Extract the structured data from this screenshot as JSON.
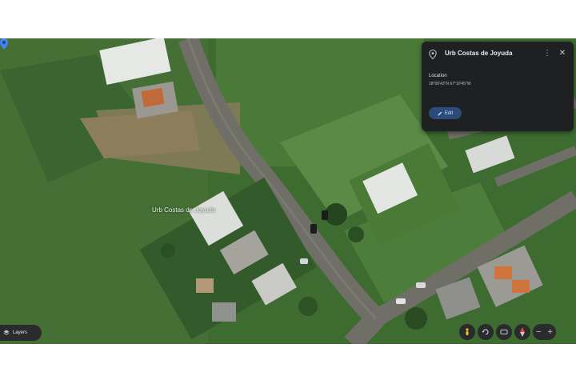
{
  "map": {
    "place_label": "Urb Costas de Joyuda"
  },
  "info_card": {
    "title": "Urb Costas de Joyuda",
    "location_label": "Location",
    "coordinates": "18°06'43\"N 67°10'45\"W",
    "edit_label": "Edit",
    "more_icon": "more-vert-icon",
    "close_icon": "close-icon"
  },
  "layers_button": {
    "label": "Layers",
    "icon": "layers-icon"
  },
  "map_controls": {
    "icons": [
      "pegman-icon",
      "rotate-icon",
      "tilt-icon",
      "compass-icon"
    ],
    "zoom_out": "−",
    "zoom_in": "+"
  },
  "colors": {
    "card_bg": "#1f2021",
    "pin_blue": "#4285f4",
    "edit_bg": "#2b4c7a"
  }
}
